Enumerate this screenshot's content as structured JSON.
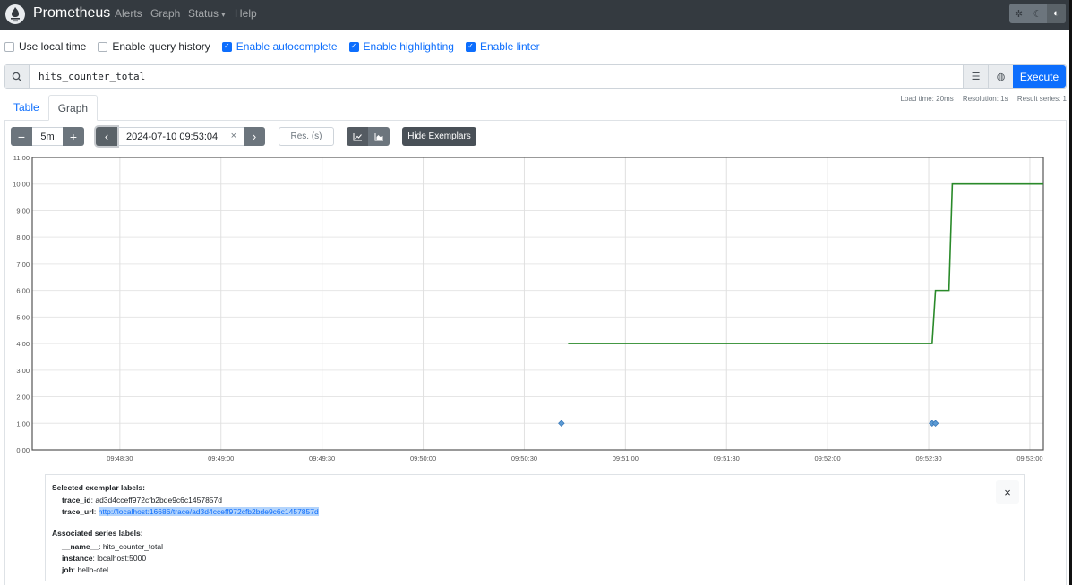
{
  "navbar": {
    "brand": "Prometheus",
    "links": [
      "Alerts",
      "Graph",
      "Status",
      "Help"
    ],
    "status_caret": "▾",
    "theme_buttons": [
      {
        "icon": "sun-gear-icon",
        "glyph": "✲"
      },
      {
        "icon": "moon-icon",
        "glyph": "☾"
      },
      {
        "icon": "half-circle-icon",
        "glyph": "◐"
      }
    ]
  },
  "options": [
    {
      "label": "Use local time",
      "checked": false
    },
    {
      "label": "Enable query history",
      "checked": false
    },
    {
      "label": "Enable autocomplete",
      "checked": true
    },
    {
      "label": "Enable highlighting",
      "checked": true
    },
    {
      "label": "Enable linter",
      "checked": true
    }
  ],
  "query": {
    "value": "hits_counter_total",
    "execute_label": "Execute",
    "search_glyph": "🔍",
    "format_glyph": "☰",
    "metrics_glyph": "◍"
  },
  "stats": {
    "load_time": "Load time: 20ms",
    "resolution": "Resolution: 1s",
    "result_series": "Result series: 1"
  },
  "tabs": [
    {
      "label": "Table",
      "active": false
    },
    {
      "label": "Graph",
      "active": true
    }
  ],
  "controls": {
    "minus": "−",
    "range": "5m",
    "plus": "+",
    "prev": "‹",
    "end_time": "2024-07-10 09:53:04",
    "clear": "×",
    "next": "›",
    "res_placeholder": "Res. (s)",
    "line_glyph": "⩘",
    "stacked_glyph": "▟",
    "hide_exemplars": "Hide Exemplars"
  },
  "chart_data": {
    "type": "line",
    "title": "",
    "xlabel": "",
    "ylabel": "",
    "x_range": [
      "09:48:04",
      "09:53:04"
    ],
    "ylim": [
      0,
      11
    ],
    "y_ticks": [
      "0.00",
      "1.00",
      "2.00",
      "3.00",
      "4.00",
      "5.00",
      "6.00",
      "7.00",
      "8.00",
      "9.00",
      "10.00",
      "11.00"
    ],
    "x_ticks": [
      "09:48:30",
      "09:49:00",
      "09:49:30",
      "09:50:00",
      "09:50:30",
      "09:51:00",
      "09:51:30",
      "09:52:00",
      "09:52:30",
      "09:53:00"
    ],
    "grid": true,
    "series": [
      {
        "name": "hits_counter_total{instance=\"localhost:5000\", job=\"hello-otel\"}",
        "color": "#2a8a2a",
        "points": [
          {
            "t": "09:50:43",
            "v": 4
          },
          {
            "t": "09:52:31",
            "v": 4
          },
          {
            "t": "09:52:32",
            "v": 6
          },
          {
            "t": "09:52:36",
            "v": 6
          },
          {
            "t": "09:52:37",
            "v": 10
          },
          {
            "t": "09:53:04",
            "v": 10
          }
        ]
      }
    ],
    "exemplars": [
      {
        "t": "09:50:41",
        "v": 1
      },
      {
        "t": "09:52:31",
        "v": 1
      },
      {
        "t": "09:52:32",
        "v": 1
      }
    ],
    "exemplar_color": "#5b9bd5"
  },
  "exemplar_panel": {
    "selected_heading": "Selected exemplar labels:",
    "selected": [
      {
        "key": "trace_id",
        "value": "ad3d4cceff972cfb2bde9c6c1457857d"
      },
      {
        "key": "trace_url",
        "value": "http://localhost:16686/trace/ad3d4cceff972cfb2bde9c6c1457857d"
      }
    ],
    "series_heading": "Associated series labels:",
    "series": [
      {
        "key": "__name__",
        "value": "hits_counter_total"
      },
      {
        "key": "instance",
        "value": "localhost:5000"
      },
      {
        "key": "job",
        "value": "hello-otel"
      }
    ],
    "close": "×"
  }
}
